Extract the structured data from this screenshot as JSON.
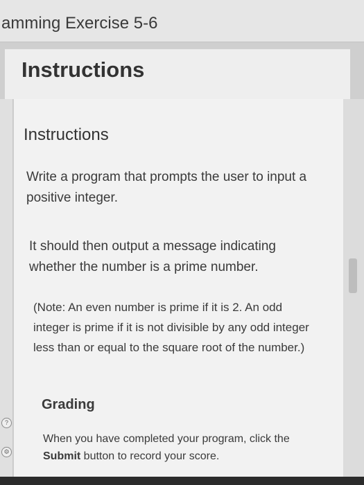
{
  "titlebar": {
    "title": "amming Exercise 5-6"
  },
  "header": {
    "title": "Instructions"
  },
  "content": {
    "heading": "Instructions",
    "paragraphs": [
      "Write a program that prompts the user to input a positive integer.",
      "It should then output a message indicating whether the number is a prime number.",
      "(Note: An even number is prime if it is 2. An odd integer is prime if it is not divisible by any odd integer less than or equal to the square root of the number.)"
    ],
    "grading_heading": "Grading",
    "grading_before": "When you have completed your program, click the ",
    "grading_bold": "Submit",
    "grading_after": " button to record your score."
  },
  "rail": {
    "help_glyph": "?",
    "settings_glyph": "⚙"
  }
}
